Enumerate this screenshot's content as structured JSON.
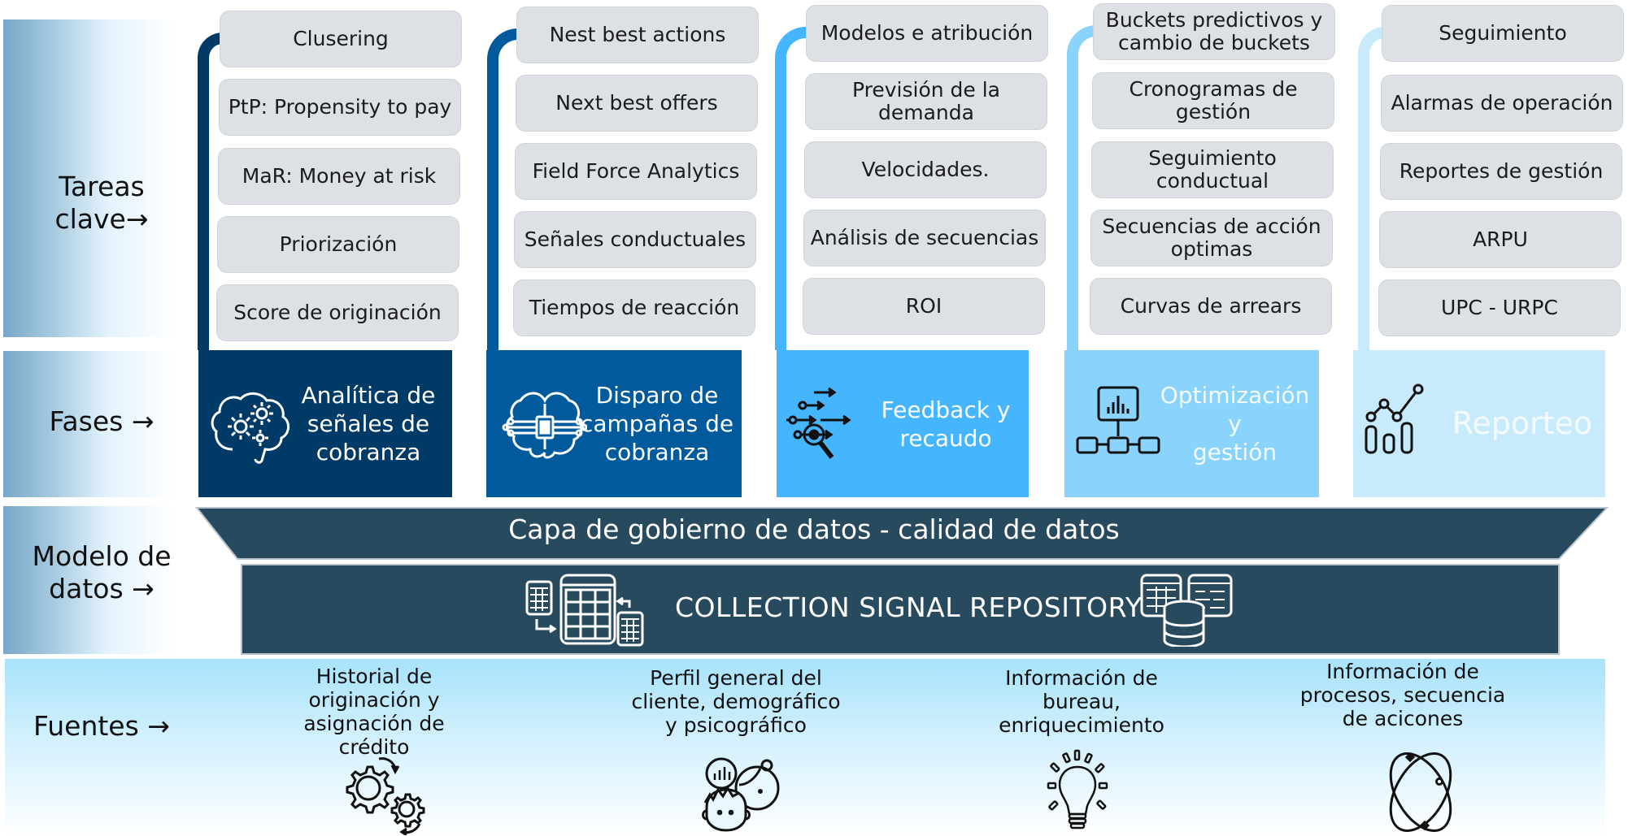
{
  "row_labels": {
    "tasks": [
      "Tareas",
      "clave→"
    ],
    "phases": "Fases →",
    "data_model": [
      "Modelo de",
      "datos →"
    ],
    "sources": "Fuentes →"
  },
  "columns": [
    {
      "color": "#003a66",
      "phase_title": [
        "Analítica de",
        "señales de",
        "cobranza"
      ],
      "phase_icon": "brain-gears-icon",
      "tasks": [
        [
          "Clusering"
        ],
        [
          "PtP: Propensity to pay"
        ],
        [
          "MaR: Money at risk"
        ],
        [
          "Priorización"
        ],
        [
          "Score de originación"
        ]
      ]
    },
    {
      "color": "#005a9b",
      "phase_title": [
        "Disparo de",
        "campañas de",
        "cobranza"
      ],
      "phase_icon": "brain-circuit-icon",
      "tasks": [
        [
          "Nest best actions"
        ],
        [
          "Next best offers"
        ],
        [
          "Field Force Analytics"
        ],
        [
          "Señales conductuales"
        ],
        [
          "Tiempos de reacción"
        ]
      ]
    },
    {
      "color": "#45b6fd",
      "phase_title": [
        "Feedback y",
        "recaudo"
      ],
      "phase_icon": "arrows-magnifier-icon",
      "tasks": [
        [
          "Modelos e atribución"
        ],
        [
          "Previsión de la",
          "demanda"
        ],
        [
          "Velocidades."
        ],
        [
          "Análisis de secuencias"
        ],
        [
          "ROI"
        ]
      ]
    },
    {
      "color": "#89d3fc",
      "phase_title": [
        "Optimización y",
        "gestión"
      ],
      "phase_icon": "monitor-network-icon",
      "tasks": [
        [
          "Buckets predictivos y",
          "cambio de buckets"
        ],
        [
          "Cronogramas de",
          "gestión"
        ],
        [
          "Seguimiento",
          "conductual"
        ],
        [
          "Secuencias de acción",
          "optimas"
        ],
        [
          "Curvas de arrears"
        ]
      ]
    },
    {
      "color": "#c7ebfc",
      "phase_title": [
        "Reporteo"
      ],
      "phase_icon": "line-bar-chart-icon",
      "tasks": [
        [
          "Seguimiento"
        ],
        [
          "Alarmas de operación"
        ],
        [
          "Reportes de gestión"
        ],
        [
          "ARPU"
        ],
        [
          "UPC - URPC"
        ]
      ]
    }
  ],
  "data_layer": {
    "governance": "Capa de gobierno de datos - calidad de datos",
    "repository": "COLLECTION SIGNAL REPOSITORY",
    "color": "#284a5e"
  },
  "sources": [
    {
      "lines": [
        "Historial de",
        "originación y",
        "asignación de",
        "crédito"
      ],
      "icon": "gears-cycle-icon"
    },
    {
      "lines": [
        "Perfil general del",
        "cliente, demográfico",
        "y psicográfico"
      ],
      "icon": "people-profile-icon"
    },
    {
      "lines": [
        "Información de",
        "bureau,",
        "enriquecimiento"
      ],
      "icon": "lightbulb-icon"
    },
    {
      "lines": [
        "Información de",
        "procesos, secuencia",
        "de acicones"
      ],
      "icon": "orbit-icon"
    }
  ]
}
